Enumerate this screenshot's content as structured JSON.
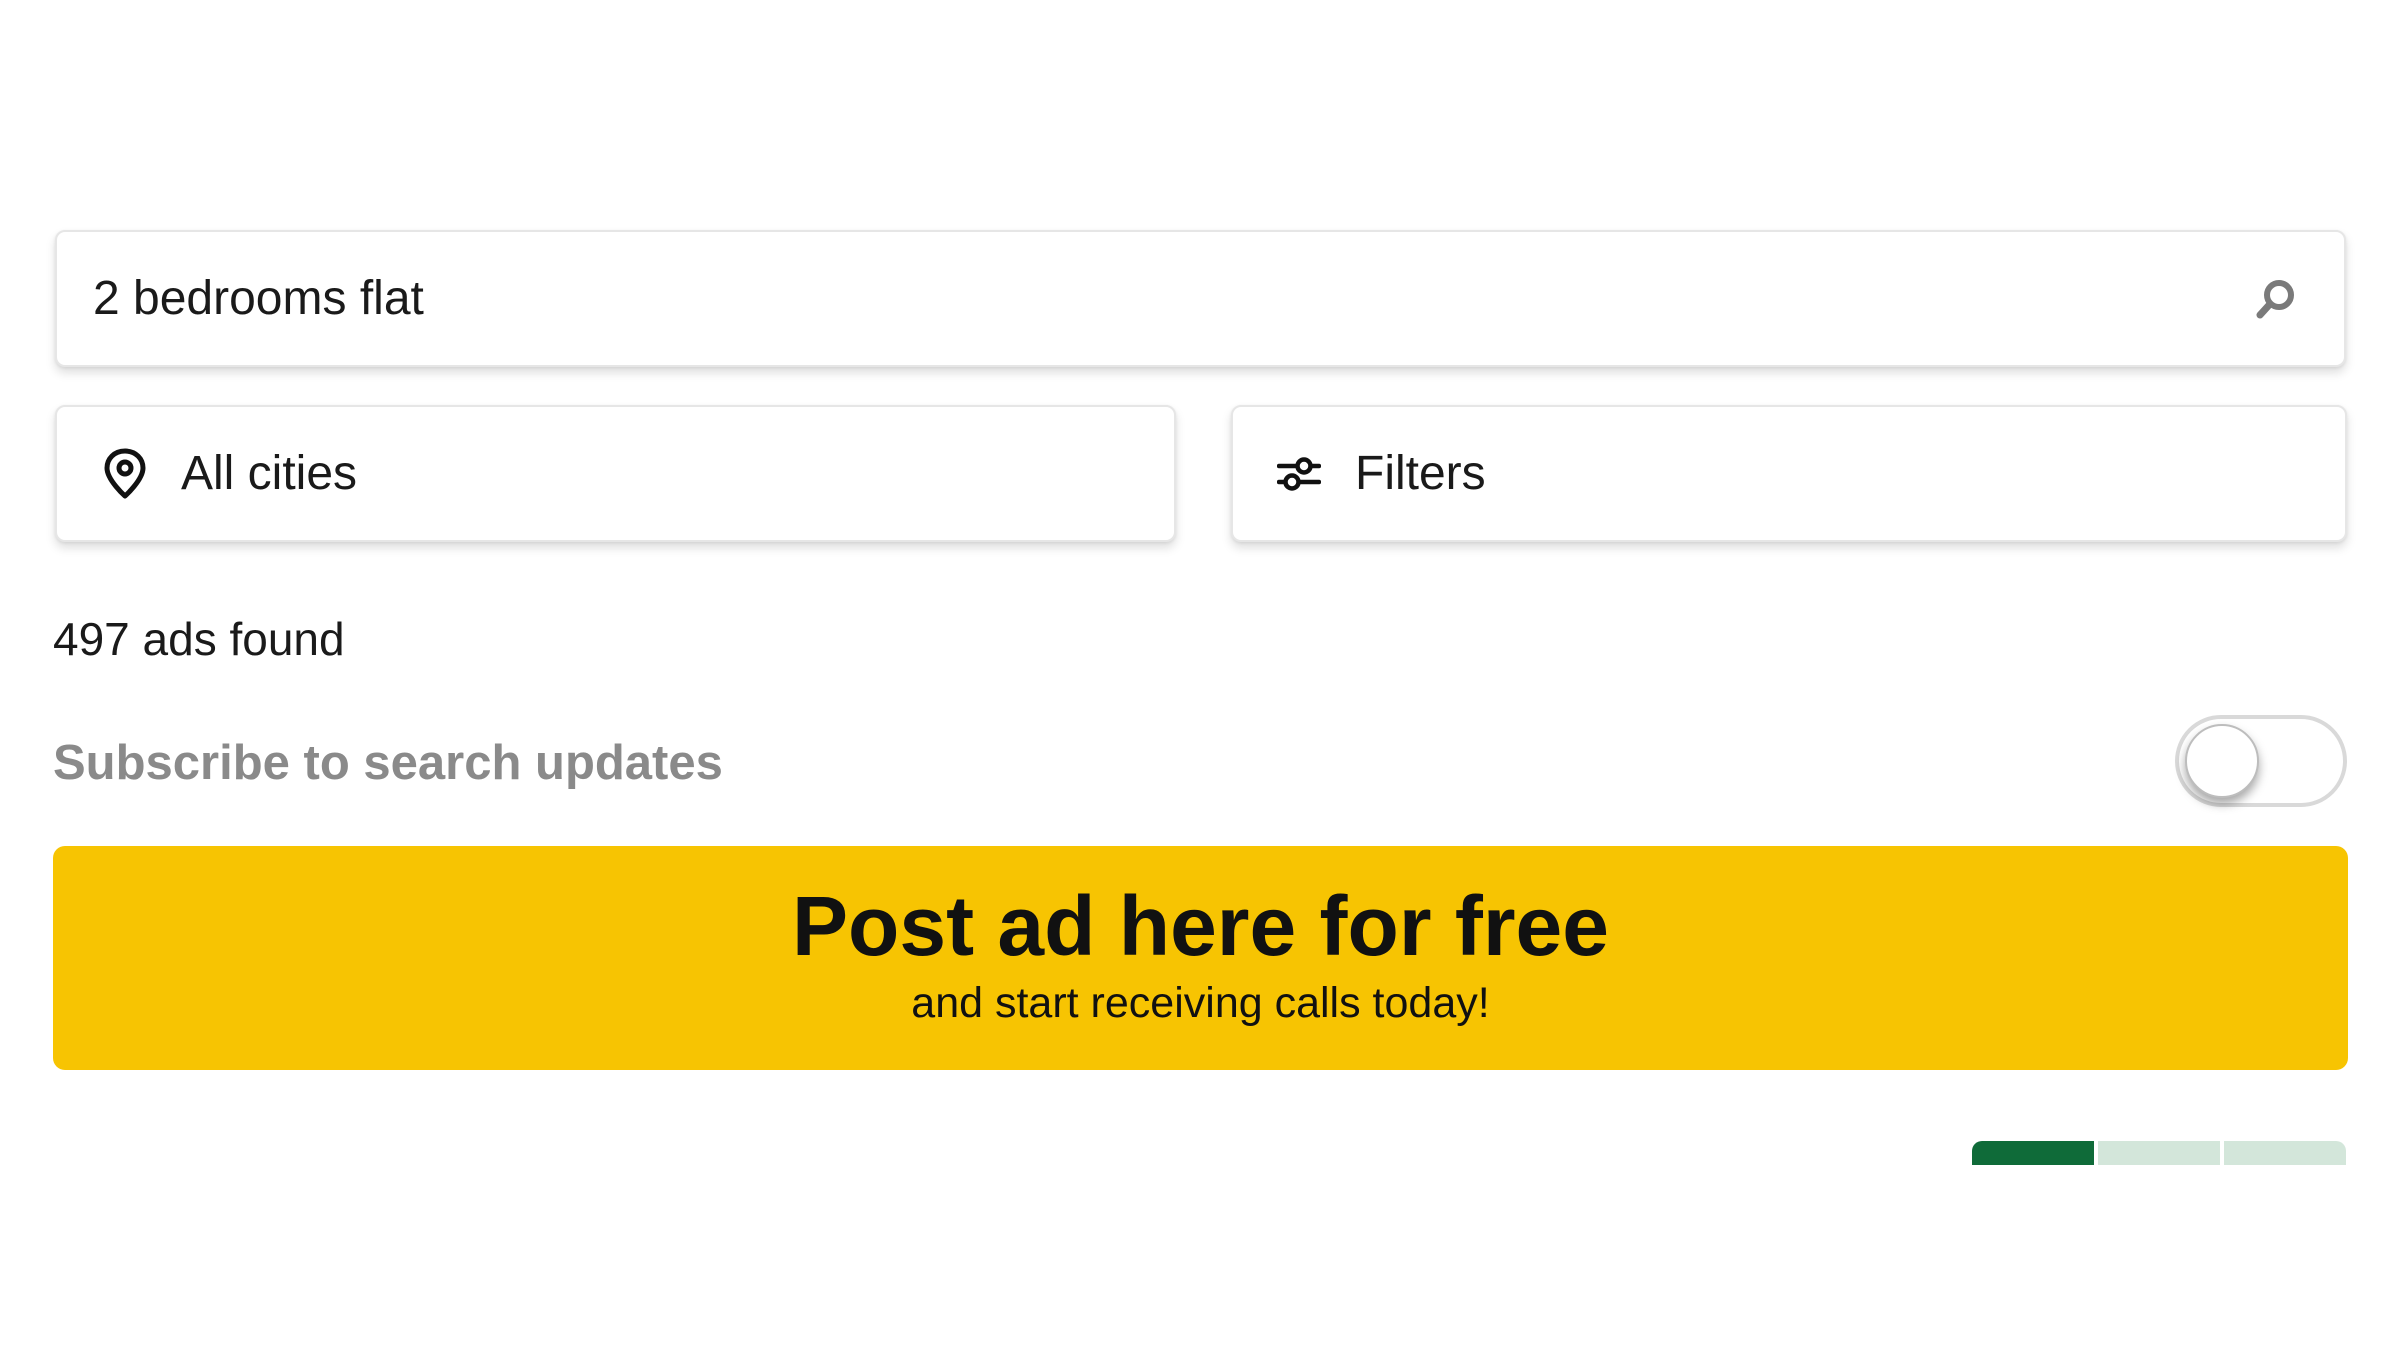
{
  "search": {
    "value": "2 bedrooms flat",
    "icon": "search-icon"
  },
  "location": {
    "label": "All cities",
    "icon": "location-pin-icon"
  },
  "filters": {
    "label": "Filters",
    "icon": "sliders-icon"
  },
  "results": {
    "count_text": "497 ads found"
  },
  "subscribe": {
    "label": "Subscribe to search updates",
    "enabled": false
  },
  "cta": {
    "title": "Post ad here for free",
    "subtitle": "and start receiving calls today!"
  },
  "pager": {
    "segments": 3,
    "active_index": 0
  },
  "colors": {
    "cta_background": "#f7c402",
    "pager_active": "#0f6b39",
    "pager_inactive": "#d3e6da",
    "muted_text": "#8a8a8a"
  }
}
